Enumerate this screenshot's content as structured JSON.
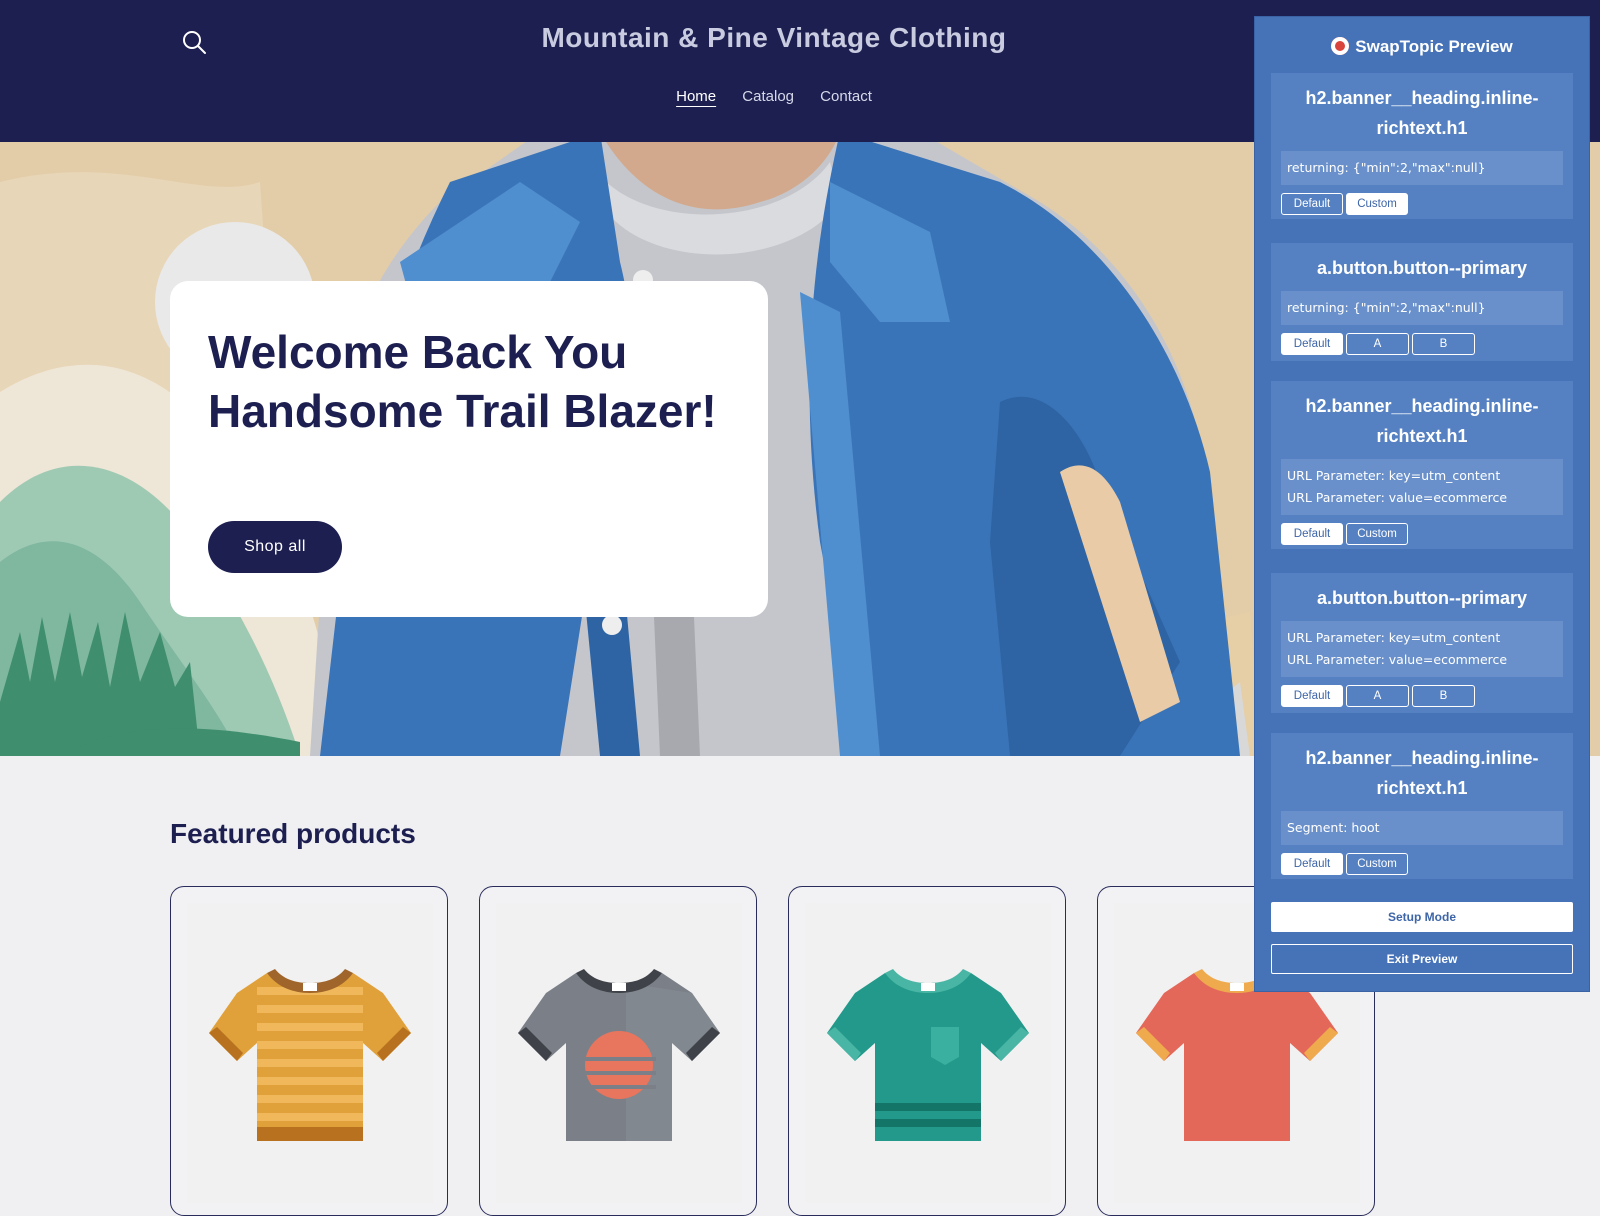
{
  "header": {
    "brand": "Mountain & Pine Vintage Clothing",
    "search_icon": "search-icon",
    "nav": [
      {
        "label": "Home",
        "active": true
      },
      {
        "label": "Catalog",
        "active": false
      },
      {
        "label": "Contact",
        "active": false
      }
    ]
  },
  "banner": {
    "heading": "Welcome Back You Handsome Trail Blazer!",
    "button_label": "Shop all"
  },
  "featured": {
    "title": "Featured products",
    "products": [
      {
        "icon": "tshirt-striped-orange-icon",
        "color": "#e0a23a"
      },
      {
        "icon": "tshirt-gray-sunset-icon",
        "color": "#7b8088"
      },
      {
        "icon": "tshirt-green-pocket-icon",
        "color": "#25a08e"
      },
      {
        "icon": "tshirt-red-icon",
        "color": "#e86e5e"
      }
    ]
  },
  "panel": {
    "title": "SwapTopic Preview",
    "title_icon": "target-icon",
    "rules": [
      {
        "selector": "h2.banner__heading.inline-richtext.h1",
        "conditions": [
          "returning: {\"min\":2,\"max\":null}"
        ],
        "buttons": [
          "Default",
          "Custom"
        ],
        "selected": 1
      },
      {
        "selector": "a.button.button--primary",
        "conditions": [
          "returning: {\"min\":2,\"max\":null}"
        ],
        "buttons": [
          "Default",
          "A",
          "B"
        ],
        "selected": 0
      },
      {
        "selector": "h2.banner__heading.inline-richtext.h1",
        "conditions": [
          "URL Parameter: key=utm_content",
          "URL Parameter: value=ecommerce"
        ],
        "buttons": [
          "Default",
          "Custom"
        ],
        "selected": 0
      },
      {
        "selector": "a.button.button--primary",
        "conditions": [
          "URL Parameter: key=utm_content",
          "URL Parameter: value=ecommerce"
        ],
        "buttons": [
          "Default",
          "A",
          "B"
        ],
        "selected": 0
      },
      {
        "selector": "h2.banner__heading.inline-richtext.h1",
        "conditions": [
          "Segment: hoot"
        ],
        "buttons": [
          "Default",
          "Custom"
        ],
        "selected": 0
      }
    ],
    "setup_label": "Setup Mode",
    "exit_label": "Exit Preview"
  },
  "colors": {
    "header_bg": "#1c1f50",
    "panel_bg": "#4672b8",
    "accent_dark": "#1c1f50"
  }
}
